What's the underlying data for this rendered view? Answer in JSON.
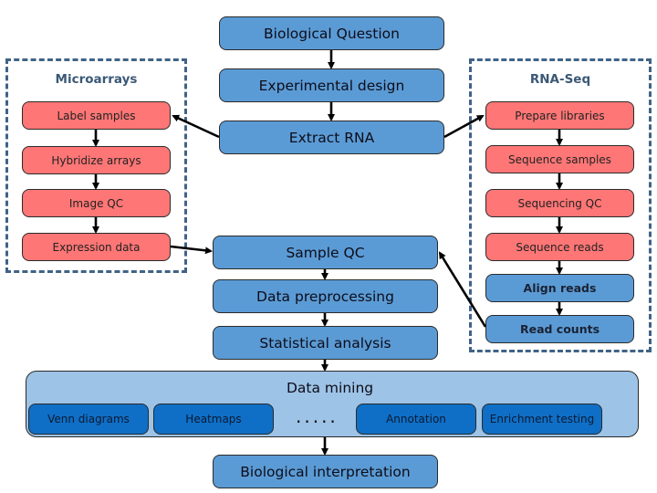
{
  "colors": {
    "main_step": "#5b9bd5",
    "platform_step": "#ff7676",
    "mining_panel": "#9dc3e6",
    "mining_item": "#0f6fc6",
    "group_border": "#3f6386"
  },
  "main_flow": {
    "biological_question": "Biological Question",
    "experimental_design": "Experimental design",
    "extract_rna": "Extract RNA",
    "sample_qc": "Sample QC",
    "data_preprocessing": "Data preprocessing",
    "statistical_analysis": "Statistical analysis",
    "biological_interpretation": "Biological interpretation"
  },
  "microarrays": {
    "title": "Microarrays",
    "steps": [
      "Label samples",
      "Hybridize arrays",
      "Image QC",
      "Expression data"
    ]
  },
  "rnaseq": {
    "title": "RNA-Seq",
    "steps": [
      "Prepare libraries",
      "Sequence samples",
      "Sequencing QC",
      "Sequence reads",
      "Align reads",
      "Read counts"
    ]
  },
  "data_mining": {
    "title": "Data mining",
    "items": [
      "Venn diagrams",
      "Heatmaps",
      "Annotation",
      "Enrichment testing"
    ],
    "ellipsis": "....."
  }
}
